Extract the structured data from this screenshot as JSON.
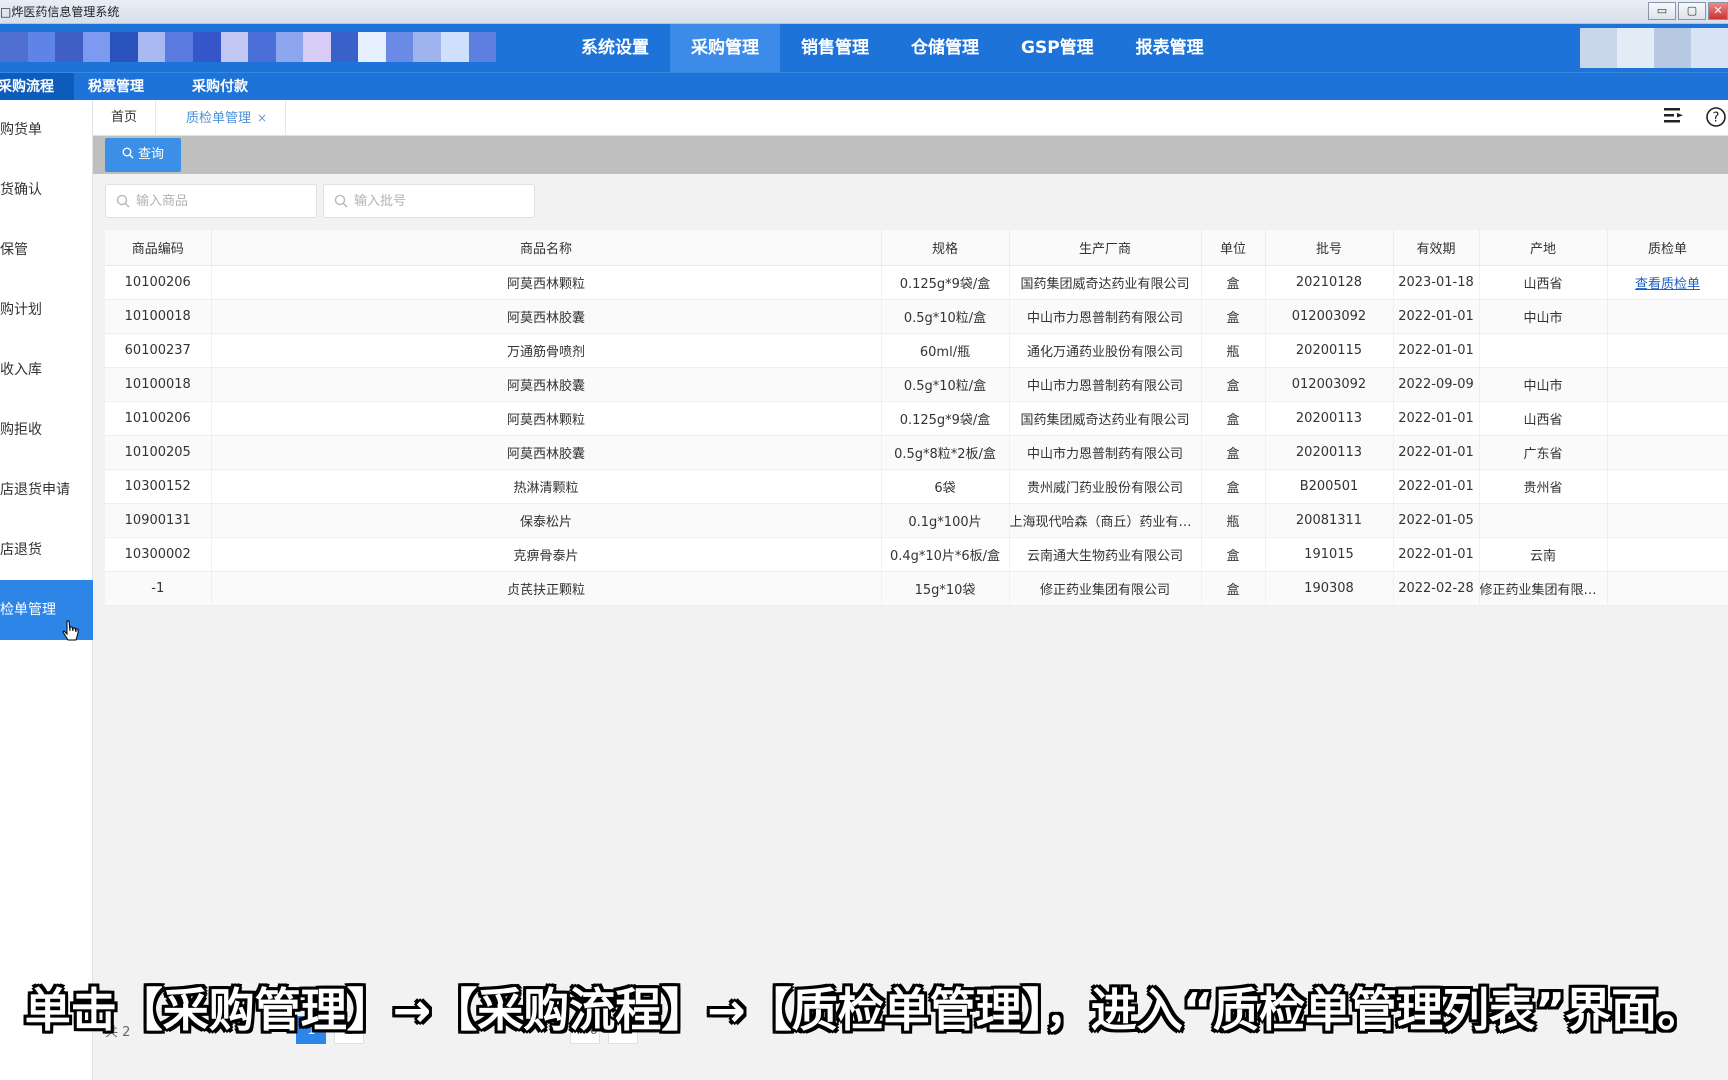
{
  "window": {
    "title": "□烨医药信息管理系统",
    "buttons": [
      "▭",
      "▢",
      "✕"
    ]
  },
  "topnav": {
    "items": [
      "系统设置",
      "采购管理",
      "销售管理",
      "仓储管理",
      "GSP管理",
      "报表管理"
    ],
    "active_index": 1
  },
  "subnav": {
    "items": [
      "采购流程",
      "税票管理",
      "采购付款"
    ],
    "active_index": 0
  },
  "sidebar": {
    "items": [
      "购货单",
      "货确认",
      "保管",
      "购计划",
      "收入库",
      "购拒收",
      "店退货申请",
      "店退货",
      "检单管理"
    ],
    "active_index": 8
  },
  "tabs": {
    "home": "首页",
    "current": "质检单管理",
    "close": "×"
  },
  "toolbar": {
    "query_label": "查询"
  },
  "filters": {
    "product_placeholder": "输入商品",
    "batch_placeholder": "输入批号"
  },
  "table": {
    "columns": [
      "商品编码",
      "商品名称",
      "规格",
      "生产厂商",
      "单位",
      "批号",
      "有效期",
      "产地",
      "质检单"
    ],
    "rows": [
      [
        "10100206",
        "阿莫西林颗粒",
        "0.125g*9袋/盒",
        "国药集团威奇达药业有限公司",
        "盒",
        "20210128",
        "2023-01-18",
        "山西省",
        "查看质检单"
      ],
      [
        "10100018",
        "阿莫西林胶囊",
        "0.5g*10粒/盒",
        "中山市力恩普制药有限公司",
        "盒",
        "012003092",
        "2022-01-01",
        "中山市",
        ""
      ],
      [
        "60100237",
        "万通筋骨喷剂",
        "60ml/瓶",
        "通化万通药业股份有限公司",
        "瓶",
        "20200115",
        "2022-01-01",
        "",
        ""
      ],
      [
        "10100018",
        "阿莫西林胶囊",
        "0.5g*10粒/盒",
        "中山市力恩普制药有限公司",
        "盒",
        "012003092",
        "2022-09-09",
        "中山市",
        ""
      ],
      [
        "10100206",
        "阿莫西林颗粒",
        "0.125g*9袋/盒",
        "国药集团威奇达药业有限公司",
        "盒",
        "20200113",
        "2022-01-01",
        "山西省",
        ""
      ],
      [
        "10100205",
        "阿莫西林胶囊",
        "0.5g*8粒*2板/盒",
        "中山市力恩普制药有限公司",
        "盒",
        "20200113",
        "2022-01-01",
        "广东省",
        ""
      ],
      [
        "10300152",
        "热淋清颗粒",
        "6袋",
        "贵州威门药业股份有限公司",
        "盒",
        "B200501",
        "2022-01-01",
        "贵州省",
        ""
      ],
      [
        "10900131",
        "保泰松片",
        "0.1g*100片",
        "上海现代哈森（商丘）药业有限...",
        "瓶",
        "20081311",
        "2022-01-05",
        "",
        ""
      ],
      [
        "10300002",
        "克痹骨泰片",
        "0.4g*10片*6板/盒",
        "云南通大生物药业有限公司",
        "盒",
        "191015",
        "2022-01-01",
        "云南",
        ""
      ],
      [
        "-1",
        "贞芪扶正颗粒",
        "15g*10袋",
        "修正药业集团有限公司",
        "盒",
        "190308",
        "2022-02-28",
        "修正药业集团有限公...",
        ""
      ]
    ]
  },
  "pager": {
    "total_prefix": "共 2",
    "pages": [
      "1",
      "2"
    ],
    "active_page": "1",
    "last_page": "476",
    "next": "›"
  },
  "caption": "单击【采购管理】→【采购流程】→【质检单管理】，进入“质检单管理列表”界面。",
  "colors": {
    "nav_bg": "#1d73d8",
    "nav_active": "#3d8be8",
    "sidebar_active": "#2e85e8",
    "link": "#1d5fc4"
  }
}
